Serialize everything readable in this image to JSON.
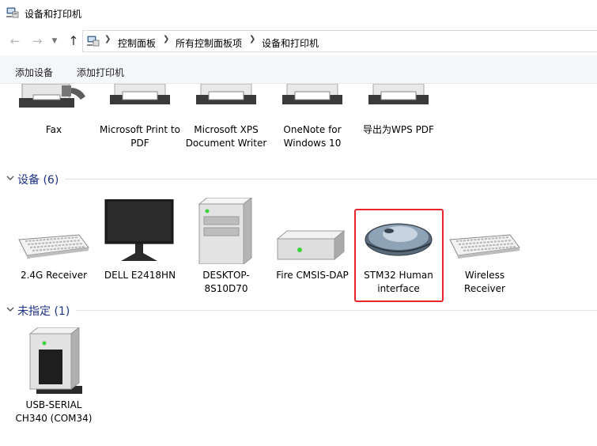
{
  "window": {
    "title": "设备和打印机"
  },
  "breadcrumb": [
    "控制面板",
    "所有控制面板项",
    "设备和打印机"
  ],
  "toolbar": {
    "add_device": "添加设备",
    "add_printer": "添加打印机"
  },
  "printers": [
    {
      "label": "Fax"
    },
    {
      "label": "Microsoft Print to PDF"
    },
    {
      "label": "Microsoft XPS Document Writer"
    },
    {
      "label": "OneNote for Windows 10"
    },
    {
      "label": "导出为WPS PDF"
    }
  ],
  "devices_group": {
    "title": "设备 (6)",
    "items": [
      {
        "label": "2.4G Receiver"
      },
      {
        "label": "DELL E2418HN"
      },
      {
        "label": "DESKTOP-8S10D70"
      },
      {
        "label": "Fire CMSIS-DAP"
      },
      {
        "label": "STM32 Human interface"
      },
      {
        "label": "Wireless Receiver"
      }
    ]
  },
  "unspecified_group": {
    "title": "未指定 (1)",
    "items": [
      {
        "label": "USB-SERIAL CH340 (COM34)"
      }
    ]
  },
  "colors": {
    "highlight_box": "#e8262a",
    "group_title": "#1e3287",
    "toolbar_bg": "#f5f7fa"
  }
}
